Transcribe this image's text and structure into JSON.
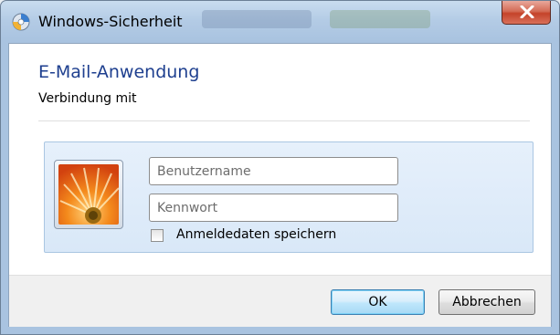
{
  "window": {
    "title": "Windows-Sicherheit",
    "close_icon": "close-icon"
  },
  "dialog": {
    "app_title": "E-Mail-Anwendung",
    "subtitle": "Verbindung mit"
  },
  "credentials": {
    "avatar_icon": "user-tile-flower-icon",
    "username": {
      "placeholder": "Benutzername",
      "value": ""
    },
    "password": {
      "placeholder": "Kennwort",
      "value": ""
    },
    "remember": {
      "label": "Anmeldedaten speichern",
      "checked": false
    }
  },
  "buttons": {
    "ok_label": "OK",
    "cancel_label": "Abbrechen"
  },
  "colors": {
    "title_blue": "#1e3f8f",
    "panel_border": "#aac6e2",
    "close_red": "#c4432a",
    "ok_border": "#3c7fb1"
  }
}
